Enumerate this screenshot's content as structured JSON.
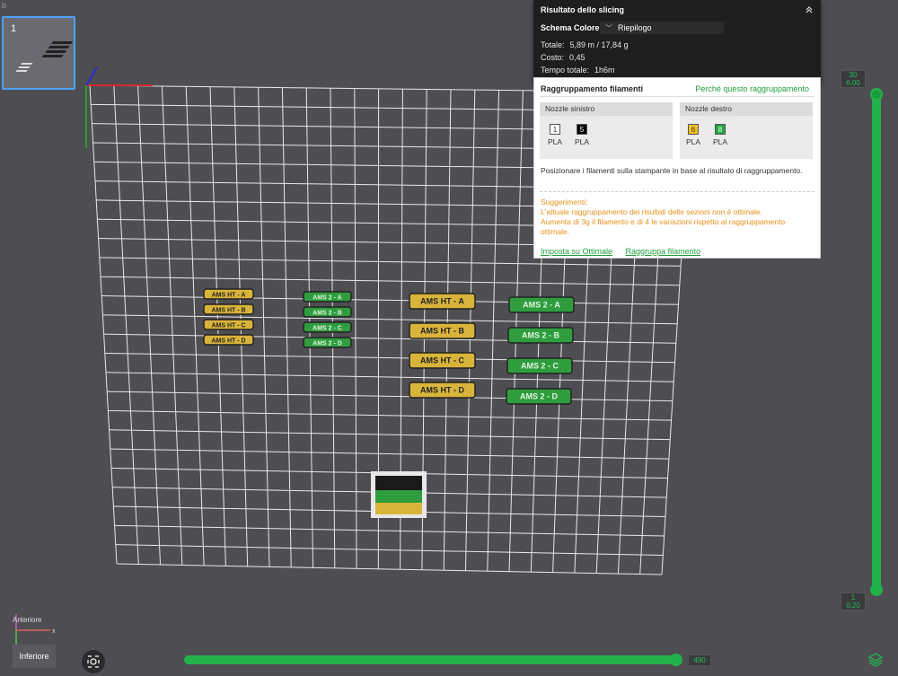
{
  "window": {
    "tab_stub": "b"
  },
  "plate": {
    "number": "1"
  },
  "labels": {
    "tag_yellow_small": [
      "AMS HT - A",
      "AMS HT - B",
      "AMS HT - C",
      "AMS HT - D"
    ],
    "tag_green_small": [
      "AMS 2 - A",
      "AMS 2 - B",
      "AMS 2 - C",
      "AMS 2 - D"
    ],
    "tag_yellow_big": [
      "AMS HT - A",
      "AMS HT - B",
      "AMS HT - C",
      "AMS HT - D"
    ],
    "tag_green_big": [
      "AMS 2 - A",
      "AMS 2 - B",
      "AMS 2 - C",
      "AMS 2 - D"
    ]
  },
  "slicing": {
    "title": "Risultato dello slicing",
    "scheme_label": "Schema Colore",
    "scheme_value": "Riepilogo",
    "total_label": "Totale:",
    "total_value": "5,89 m / 17,84 g",
    "cost_label": "Costo:",
    "cost_value": "0,45",
    "time_label": "Tempo totale:",
    "time_value": "1h6m"
  },
  "grouping": {
    "title": "Raggruppamento filamenti",
    "why_link": "Perché questo raggruppamento",
    "left_nozzle": "Nozzle sinistro",
    "right_nozzle": "Nozzle destro",
    "filaments_left": [
      {
        "id": "1",
        "type": "PLA",
        "color": "#ffffff",
        "text_color": "#333333"
      },
      {
        "id": "5",
        "type": "PLA",
        "color": "#000000",
        "text_color": "#ffffff"
      }
    ],
    "filaments_right": [
      {
        "id": "6",
        "type": "PLA",
        "color": "#f2c21a",
        "text_color": "#333333"
      },
      {
        "id": "8",
        "type": "PLA",
        "color": "#23a63f",
        "text_color": "#ffffff"
      }
    ],
    "description": "Posizionare i filamenti sulla stampante in base al risultato di raggruppamento.",
    "suggestions_title": "Suggerimenti:",
    "suggestion_1": "L'attuale raggruppamento dei risultati delle sezioni non è ottimale.",
    "suggestion_2": "Aumenta di 3g il filamento e di 4 le variazioni rispetto al raggruppamento ottimale.",
    "action_optimal": "Imposta su Ottimale",
    "action_group": "Raggruppa filamento"
  },
  "layer_slider": {
    "top_layer": "30",
    "top_height": "6.00",
    "bottom_layer": "1",
    "bottom_height": "0.20"
  },
  "move_slider": {
    "value": "490"
  },
  "view": {
    "top_label": "Anteriore",
    "bottom_label": "Inferiore",
    "axis_x": "x"
  },
  "colors": {
    "accent_green": "#22b24c",
    "selection_blue": "#4aa3ff",
    "warning": "#e8901a"
  }
}
